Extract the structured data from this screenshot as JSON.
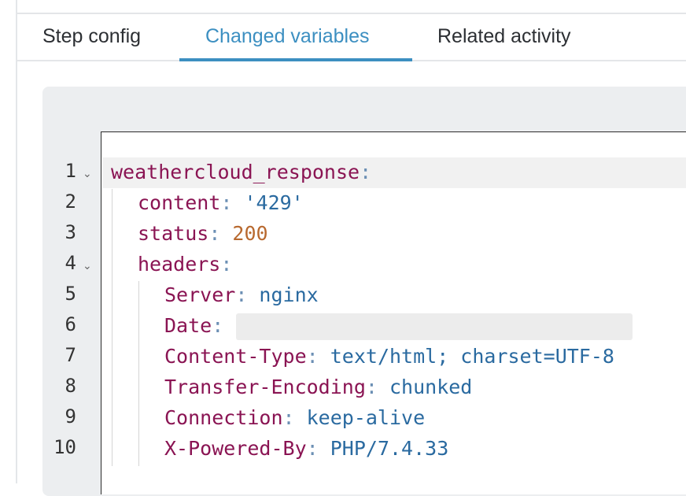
{
  "tabs": [
    {
      "label": "Step config",
      "active": false
    },
    {
      "label": "Changed variables",
      "active": true
    },
    {
      "label": "Related activity",
      "active": false
    }
  ],
  "editor": {
    "line_numbers": [
      "1",
      "2",
      "3",
      "4",
      "5",
      "6",
      "7",
      "8",
      "9",
      "10"
    ],
    "lines": [
      {
        "key": "weathercloud_response",
        "sep": ":",
        "value": "",
        "value_type": "none"
      },
      {
        "key": "content",
        "sep": ": ",
        "value": "'429'",
        "value_type": "string"
      },
      {
        "key": "status",
        "sep": ": ",
        "value": "200",
        "value_type": "number"
      },
      {
        "key": "headers",
        "sep": ":",
        "value": "",
        "value_type": "none"
      },
      {
        "key": "Server",
        "sep": ": ",
        "value": "nginx",
        "value_type": "string"
      },
      {
        "key": "Date",
        "sep": ": ",
        "value": "",
        "value_type": "redacted"
      },
      {
        "key": "Content-Type",
        "sep": ": ",
        "value": "text/html; charset=UTF-8",
        "value_type": "string"
      },
      {
        "key": "Transfer-Encoding",
        "sep": ": ",
        "value": "chunked",
        "value_type": "string"
      },
      {
        "key": "Connection",
        "sep": ": ",
        "value": "keep-alive",
        "value_type": "string"
      },
      {
        "key": "X-Powered-By",
        "sep": ": ",
        "value": "PHP/7.4.33",
        "value_type": "string"
      }
    ]
  },
  "colors": {
    "accent": "#3c8fc1",
    "yaml_key": "#8a1453",
    "yaml_string": "#2a6aa0",
    "yaml_number": "#b8692f"
  }
}
